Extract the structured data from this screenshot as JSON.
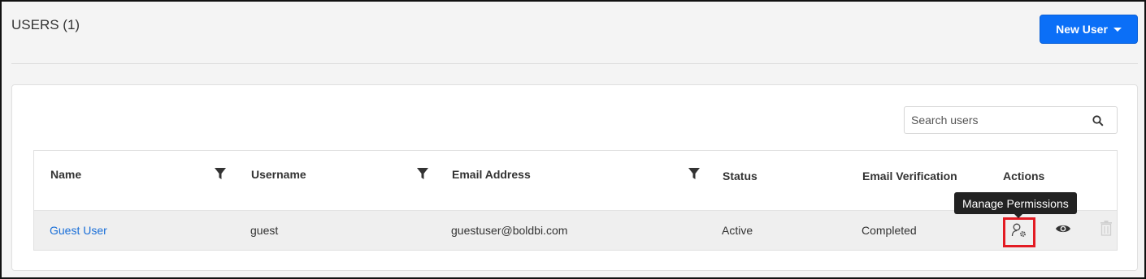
{
  "page": {
    "title": "USERS (1)",
    "new_user_label": "New User"
  },
  "search": {
    "placeholder": "Search users"
  },
  "table": {
    "columns": [
      "Name",
      "Username",
      "Email Address",
      "Status",
      "Email Verification",
      "Actions"
    ],
    "rows": [
      {
        "name": "Guest User",
        "username": "guest",
        "email": "guestuser@boldbi.com",
        "status": "Active",
        "verification": "Completed"
      }
    ]
  },
  "tooltip": {
    "text": "Manage Permissions"
  },
  "icons": [
    "chevron-down-icon",
    "search-icon",
    "filter-icon",
    "manage-permissions-icon",
    "eye-icon",
    "trash-icon"
  ],
  "colors": {
    "accent": "#0b6ff7",
    "link": "#1a6fd8",
    "highlight": "#e31b23"
  }
}
